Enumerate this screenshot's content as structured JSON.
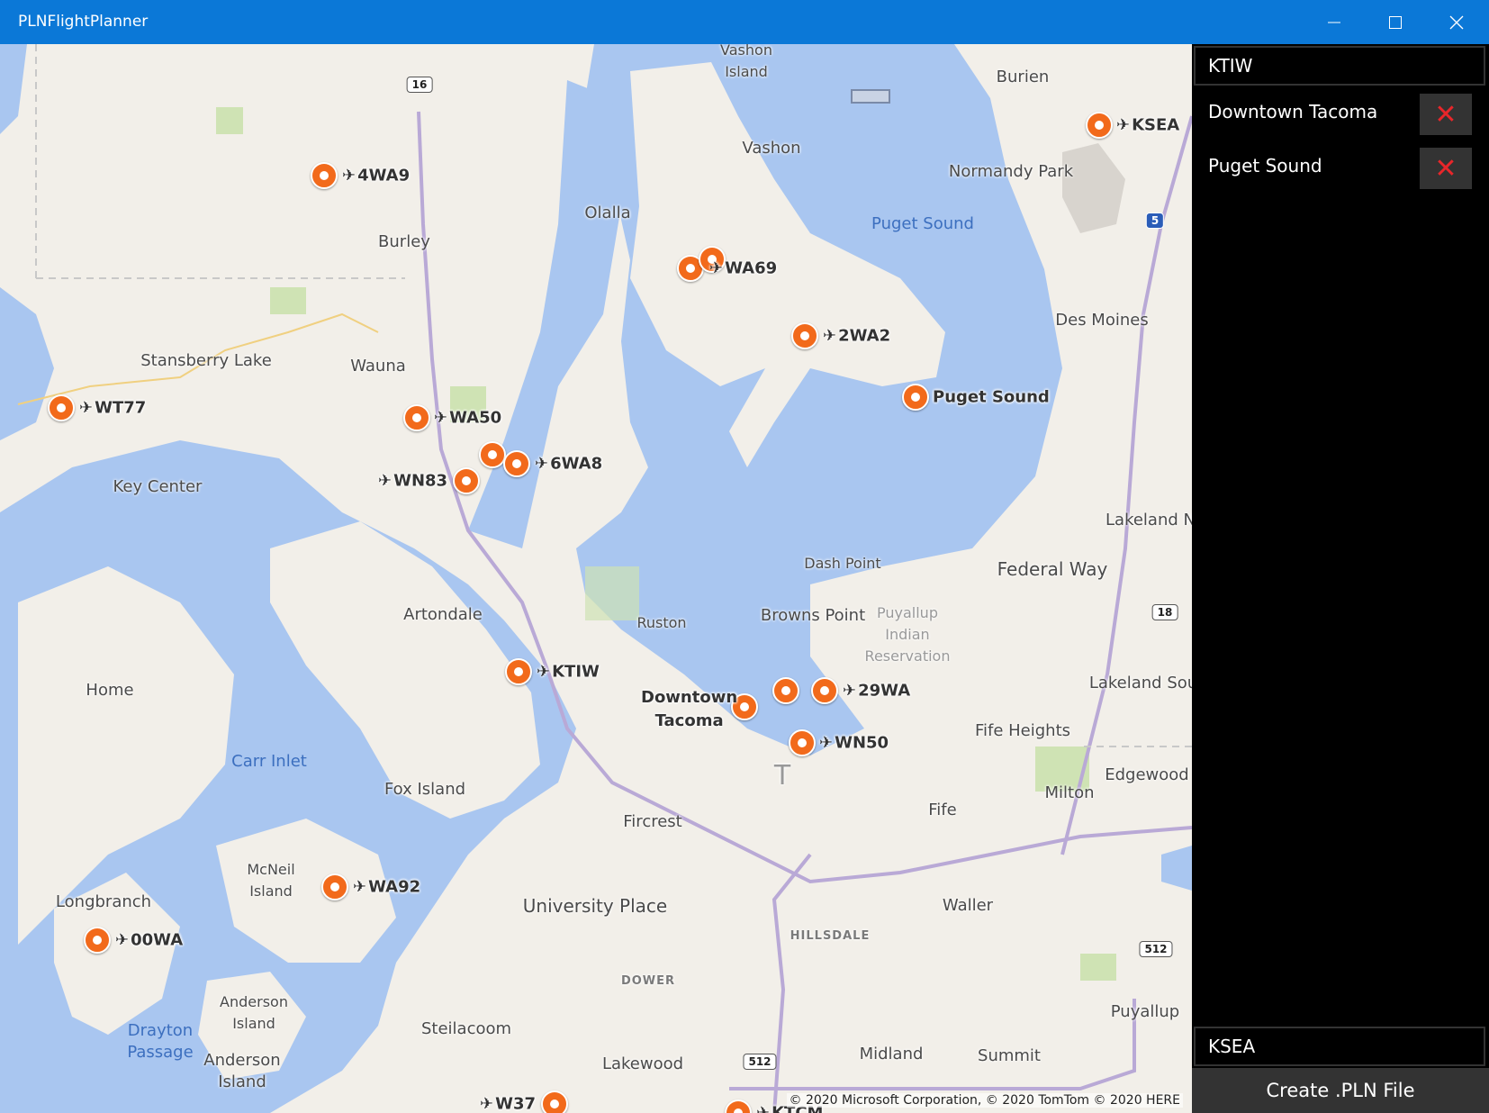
{
  "window": {
    "title": "PLNFlightPlanner",
    "minimize_icon": "minimize-icon",
    "maximize_icon": "maximize-icon",
    "close_icon": "close-icon"
  },
  "colors": {
    "titlebar": "#0b78d7",
    "water": "#a9c6f0",
    "land": "#f2efe9",
    "pin": "#f26a1b",
    "delete_x": "#e8262a",
    "panel": "#000000",
    "button": "#333333"
  },
  "map": {
    "places": [
      {
        "name": "Vashon\nIsland",
        "type": "land"
      },
      {
        "name": "Burien",
        "type": "land"
      },
      {
        "name": "Vashon",
        "type": "land"
      },
      {
        "name": "Normandy Park",
        "type": "land"
      },
      {
        "name": "Olalla",
        "type": "land"
      },
      {
        "name": "Burley",
        "type": "land"
      },
      {
        "name": "Puget Sound",
        "type": "water"
      },
      {
        "name": "Des Moines",
        "type": "land"
      },
      {
        "name": "Stansberry Lake",
        "type": "land"
      },
      {
        "name": "Wauna",
        "type": "land"
      },
      {
        "name": "Key Center",
        "type": "land"
      },
      {
        "name": "Lakeland N",
        "type": "land"
      },
      {
        "name": "Dash Point",
        "type": "land"
      },
      {
        "name": "Federal Way",
        "type": "land"
      },
      {
        "name": "Artondale",
        "type": "land"
      },
      {
        "name": "Ruston",
        "type": "land"
      },
      {
        "name": "Browns Point",
        "type": "land"
      },
      {
        "name": "Puyallup\nIndian\nReservation",
        "type": "land"
      },
      {
        "name": "Home",
        "type": "land"
      },
      {
        "name": "Lakeland Sou",
        "type": "land"
      },
      {
        "name": "Fife Heights",
        "type": "land"
      },
      {
        "name": "Carr Inlet",
        "type": "water"
      },
      {
        "name": "Fox Island",
        "type": "land"
      },
      {
        "name": "Edgewood",
        "type": "land"
      },
      {
        "name": "Milton",
        "type": "land"
      },
      {
        "name": "Fife",
        "type": "land"
      },
      {
        "name": "Fircrest",
        "type": "land"
      },
      {
        "name": "McNeil\nIsland",
        "type": "land"
      },
      {
        "name": "Longbranch",
        "type": "land"
      },
      {
        "name": "University Place",
        "type": "land"
      },
      {
        "name": "Waller",
        "type": "land"
      },
      {
        "name": "HILLSDALE",
        "type": "small"
      },
      {
        "name": "DOWER",
        "type": "small"
      },
      {
        "name": "Anderson\nIsland",
        "type": "land"
      },
      {
        "name": "Drayton\nPassage",
        "type": "water"
      },
      {
        "name": "Steilacoom",
        "type": "land"
      },
      {
        "name": "Puyallup",
        "type": "land"
      },
      {
        "name": "Anderson\nIsland",
        "type": "land"
      },
      {
        "name": "Lakewood",
        "type": "land"
      },
      {
        "name": "Midland",
        "type": "land"
      },
      {
        "name": "Summit",
        "type": "land"
      },
      {
        "name": "T",
        "type": "land"
      }
    ],
    "shields": [
      "16",
      "5",
      "18",
      "512",
      "512"
    ],
    "airports": [
      {
        "id": "KSEA",
        "icon": "airplane-icon"
      },
      {
        "id": "4WA9",
        "icon": "airplane-icon"
      },
      {
        "id": "WA69",
        "icon": "airplane-icon"
      },
      {
        "id": "2WA2",
        "icon": "airplane-icon"
      },
      {
        "id": "Puget Sound",
        "icon": ""
      },
      {
        "id": "WT77",
        "icon": "airplane-icon"
      },
      {
        "id": "WA50",
        "icon": "airplane-icon"
      },
      {
        "id": "6WA8",
        "icon": "airplane-icon"
      },
      {
        "id": "WN83",
        "icon": "airplane-icon"
      },
      {
        "id": "KTIW",
        "icon": "airplane-icon"
      },
      {
        "id": "Downtown\nTacoma",
        "icon": ""
      },
      {
        "id": "29WA",
        "icon": "airplane-icon"
      },
      {
        "id": "WN50",
        "icon": "airplane-icon"
      },
      {
        "id": "WA92",
        "icon": "airplane-icon"
      },
      {
        "id": "00WA",
        "icon": "airplane-icon"
      },
      {
        "id": "W37",
        "icon": "airplane-icon"
      },
      {
        "id": "KTCM",
        "icon": "airplane-icon"
      }
    ],
    "copyright": "© 2020 Microsoft Corporation, © 2020 TomTom © 2020 HERE"
  },
  "panel": {
    "departure": "KTIW",
    "waypoints": [
      {
        "name": "Downtown Tacoma",
        "delete_icon": "delete-x-icon"
      },
      {
        "name": "Puget Sound",
        "delete_icon": "delete-x-icon"
      }
    ],
    "destination": "KSEA",
    "create_button": "Create .PLN File"
  }
}
